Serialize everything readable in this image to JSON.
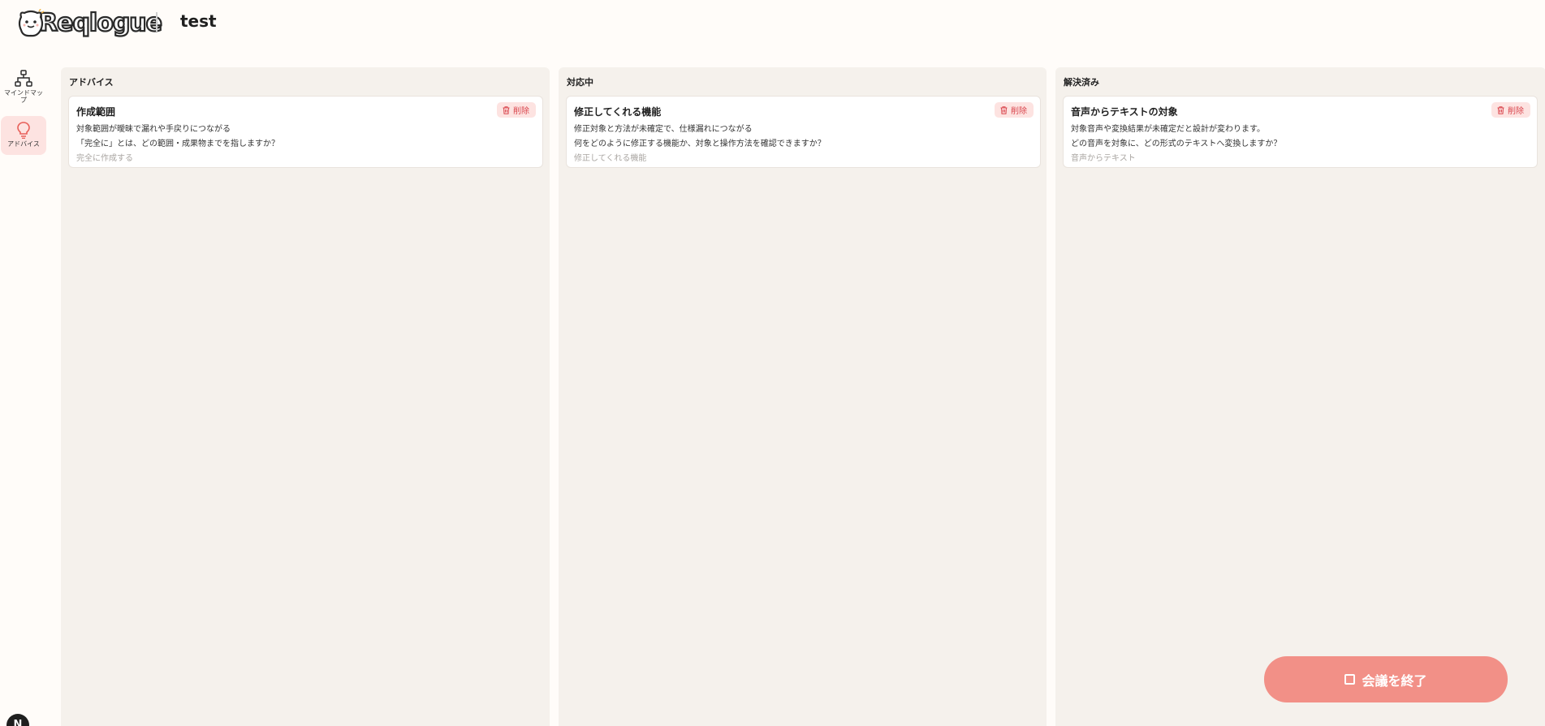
{
  "header": {
    "logo_text": "Reqlogue",
    "meeting_title": "test"
  },
  "sidebar": {
    "items": [
      {
        "label": "マインドマップ",
        "icon": "mindmap-icon",
        "active": false
      },
      {
        "label": "アドバイス",
        "icon": "lightbulb-icon",
        "active": true
      }
    ],
    "avatar_initial": "N"
  },
  "columns": [
    {
      "title": "アドバイス",
      "cards": [
        {
          "title": "作成範囲",
          "line1": "対象範囲が曖昧で漏れや手戻りにつながる",
          "line2": "「完全に」とは、どの範囲・成果物までを指しますか？",
          "source": "完全に作成する",
          "delete_label": "削除"
        }
      ]
    },
    {
      "title": "対応中",
      "cards": [
        {
          "title": "修正してくれる機能",
          "line1": "修正対象と方法が未確定で、仕様漏れにつながる",
          "line2": "何をどのように修正する機能か、対象と操作方法を確認できますか？",
          "source": "修正してくれる機能",
          "delete_label": "削除"
        }
      ]
    },
    {
      "title": "解決済み",
      "cards": [
        {
          "title": "音声からテキストの対象",
          "line1": "対象音声や変換結果が未確定だと設計が変わります。",
          "line2": "どの音声を対象に、どの形式のテキストへ変換しますか？",
          "source": "音声からテキスト",
          "delete_label": "削除"
        }
      ]
    }
  ],
  "end_meeting": {
    "label": "会議を終了"
  },
  "colors": {
    "accent": "#f29087",
    "delete_text": "#d9444c",
    "delete_bg": "#fde3e1",
    "column_bg": "#f5f1ec",
    "page_bg": "#fffcf9"
  }
}
